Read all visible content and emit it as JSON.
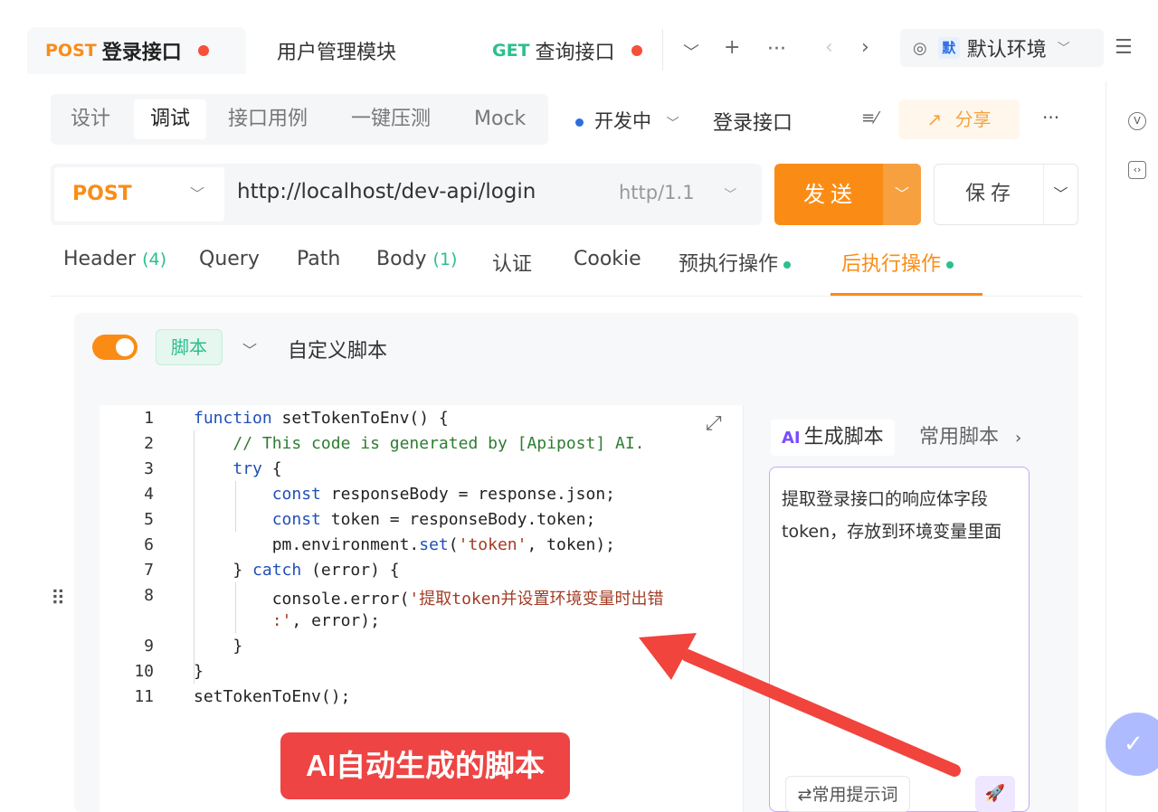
{
  "tabs": [
    {
      "method": "POST",
      "title": "登录接口"
    },
    {
      "method": "",
      "title": "用户管理模块"
    },
    {
      "method": "GET",
      "title": "查询接口"
    }
  ],
  "tab_controls": {
    "more_tabs": "﹀",
    "add": "+",
    "overflow": "···",
    "prev": "‹",
    "next": "›"
  },
  "environment": {
    "badge": "默",
    "name": "默认环境",
    "caret": "﹀"
  },
  "top_menu": "☰",
  "subtabs": [
    "设计",
    "调试",
    "接口用例",
    "一键压测",
    "Mock"
  ],
  "status": {
    "label": "开发中",
    "caret": "﹀"
  },
  "api_name": "登录接口",
  "format_icon": "≡⁄",
  "share": {
    "icon": "↗",
    "label": "分享"
  },
  "more": "···",
  "request": {
    "method": "POST",
    "method_caret": "﹀",
    "url": "http://localhost/dev-api/login",
    "http_version": "http/1.1",
    "version_caret": "﹀"
  },
  "send": {
    "label": "发送",
    "caret": "﹀"
  },
  "save": {
    "label": "保存",
    "caret": "﹀"
  },
  "param_tabs": [
    {
      "label": "Header",
      "count": "(4)"
    },
    {
      "label": "Query",
      "count": ""
    },
    {
      "label": "Path",
      "count": ""
    },
    {
      "label": "Body",
      "count": "(1)"
    },
    {
      "label": "认证",
      "count": ""
    },
    {
      "label": "Cookie",
      "count": ""
    },
    {
      "label": "预执行操作",
      "count": ""
    },
    {
      "label": "后执行操作",
      "count": ""
    }
  ],
  "script": {
    "tag": "脚本",
    "caret": "﹀",
    "title": "自定义脚本",
    "lines": [
      {
        "n": "1",
        "parts": [
          [
            "kw",
            "function"
          ],
          [
            "",
            " setTokenToEnv() {"
          ]
        ]
      },
      {
        "n": "2",
        "parts": [
          [
            "",
            "    "
          ],
          [
            "cm",
            "// This code is generated by [Apipost] AI."
          ]
        ]
      },
      {
        "n": "3",
        "parts": [
          [
            "",
            "    "
          ],
          [
            "kw",
            "try"
          ],
          [
            "",
            " {"
          ]
        ]
      },
      {
        "n": "4",
        "parts": [
          [
            "",
            "        "
          ],
          [
            "kw",
            "const"
          ],
          [
            "",
            " responseBody = response.json;"
          ]
        ]
      },
      {
        "n": "5",
        "parts": [
          [
            "",
            "        "
          ],
          [
            "kw",
            "const"
          ],
          [
            "",
            " token = responseBody.token;"
          ]
        ]
      },
      {
        "n": "6",
        "parts": [
          [
            "",
            "        pm.environment."
          ],
          [
            "kw",
            "set"
          ],
          [
            "",
            "("
          ],
          [
            "st",
            "'token'"
          ],
          [
            "",
            ", token);"
          ]
        ]
      },
      {
        "n": "7",
        "parts": [
          [
            "",
            "    } "
          ],
          [
            "kw",
            "catch"
          ],
          [
            "",
            " (error) {"
          ]
        ]
      },
      {
        "n": "8",
        "parts": [
          [
            "",
            "        console.error("
          ],
          [
            "st",
            "'提取token并设置环境变量时出错"
          ]
        ]
      },
      {
        "n": "",
        "parts": [
          [
            "",
            "        "
          ],
          [
            "st",
            ":'"
          ],
          [
            "",
            ", error);"
          ]
        ]
      },
      {
        "n": "9",
        "parts": [
          [
            "",
            "    }"
          ]
        ]
      },
      {
        "n": "10",
        "parts": [
          [
            "",
            "}"
          ]
        ]
      },
      {
        "n": "11",
        "parts": [
          [
            "",
            "setTokenToEnv();"
          ]
        ]
      }
    ]
  },
  "annotation": "AI自动生成的脚本",
  "ai_panel": {
    "tab_ai_prefix": "AI",
    "tab_ai": "生成脚本",
    "tab_common": "常用脚本",
    "next": "›",
    "prompt": "提取登录接口的响应体字段token，存放到环境变量里面",
    "hint_button": "⇄常用提示词",
    "send_icon": "🚀"
  },
  "rail": {
    "top_icon": "V",
    "second_icon": "‹›"
  },
  "float_icon": "✓",
  "colors": {
    "accent": "#fa8c16",
    "green": "#2bbf8f",
    "annotation": "#ee4444",
    "ai_border": "#c9a6f5"
  }
}
